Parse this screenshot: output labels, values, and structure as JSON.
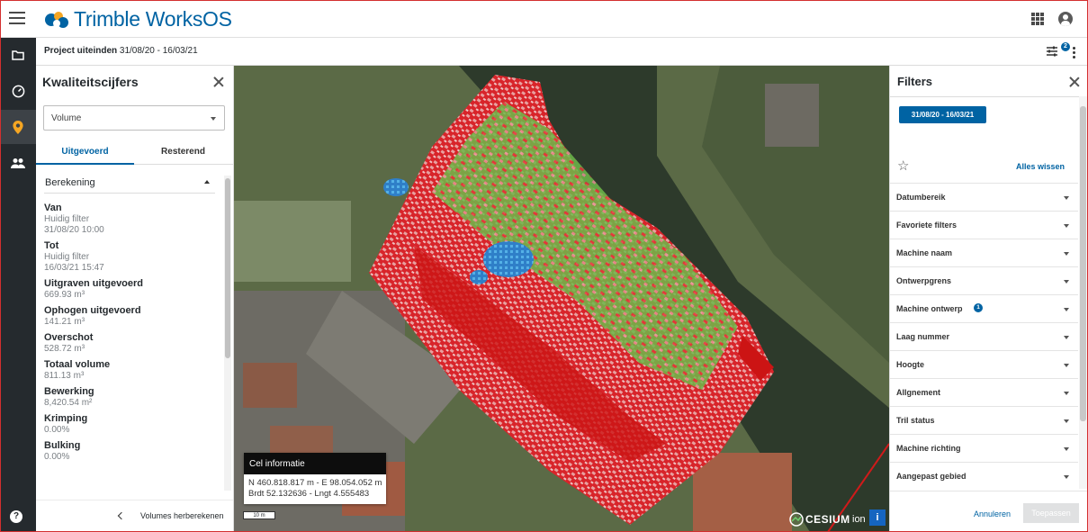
{
  "app": {
    "brand": "Trimble WorksOS",
    "brand_color": "#0063a3"
  },
  "project": {
    "label": "Project uiteinden",
    "dates": "31/08/20 - 16/03/21",
    "filter_count": "2"
  },
  "left_panel": {
    "title": "Kwaliteitscijfers",
    "select_value": "Volume",
    "tabs": [
      {
        "label": "Uitgevoerd",
        "active": true
      },
      {
        "label": "Resterend",
        "active": false
      }
    ],
    "section": "Berekening",
    "metrics": [
      {
        "label": "Van",
        "values": [
          "Huidig filter",
          "31/08/20 10:00"
        ]
      },
      {
        "label": "Tot",
        "values": [
          "Huidig filter",
          "16/03/21 15:47"
        ]
      },
      {
        "label": "Uitgraven uitgevoerd",
        "values": [
          "669.93 m³"
        ]
      },
      {
        "label": "Ophogen uitgevoerd",
        "values": [
          "141.21 m³"
        ]
      },
      {
        "label": "Overschot",
        "values": [
          "528.72 m³"
        ]
      },
      {
        "label": "Totaal volume",
        "values": [
          "811.13 m³"
        ]
      },
      {
        "label": "Bewerking",
        "values": [
          "8,420.54 m²"
        ]
      },
      {
        "label": "Krimping",
        "values": [
          "0.00%"
        ]
      },
      {
        "label": "Bulking",
        "values": [
          "0.00%"
        ]
      }
    ],
    "footer_button": "Volumes herberekenen"
  },
  "map": {
    "cell_info": {
      "title": "Cel informatie",
      "line1": "N 460.818.817 m - E 98.054.052 m",
      "line2": "Brdt 52.132636 - Lngt 4.555483"
    },
    "scale_label": "10 m",
    "attribution": {
      "name": "CESIUM",
      "suffix": "ion"
    },
    "info_label": "i"
  },
  "right_panel": {
    "title": "Filters",
    "date_chip": "31/08/20 - 16/03/21",
    "clear_all": "Alles wissen",
    "filters": [
      {
        "label": "Datumbereik"
      },
      {
        "label": "Favoriete filters"
      },
      {
        "label": "Machine naam"
      },
      {
        "label": "Ontwerpgrens"
      },
      {
        "label": "Machine ontwerp",
        "badge": "1"
      },
      {
        "label": "Laag nummer"
      },
      {
        "label": "Hoogte"
      },
      {
        "label": "Allgnement"
      },
      {
        "label": "Tril status"
      },
      {
        "label": "Machine richting"
      },
      {
        "label": "Aangepast gebied"
      }
    ],
    "cancel": "Annuleren",
    "apply": "Toepassen"
  },
  "nav": {
    "help": "?"
  }
}
